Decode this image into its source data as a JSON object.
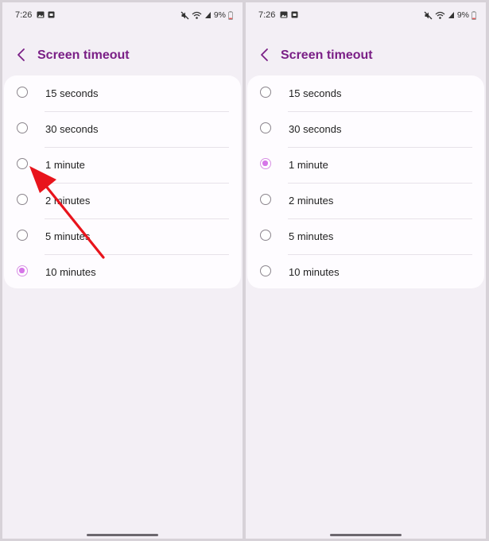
{
  "left_screen": {
    "status": {
      "time": "7:26",
      "battery": "9%"
    },
    "title": "Screen timeout",
    "options": [
      {
        "label": "15 seconds",
        "selected": false
      },
      {
        "label": "30 seconds",
        "selected": false
      },
      {
        "label": "1 minute",
        "selected": false
      },
      {
        "label": "2 minutes",
        "selected": false
      },
      {
        "label": "5 minutes",
        "selected": false
      },
      {
        "label": "10 minutes",
        "selected": true
      }
    ]
  },
  "right_screen": {
    "status": {
      "time": "7:26",
      "battery": "9%"
    },
    "title": "Screen timeout",
    "options": [
      {
        "label": "15 seconds",
        "selected": false
      },
      {
        "label": "30 seconds",
        "selected": false
      },
      {
        "label": "1 minute",
        "selected": true
      },
      {
        "label": "2 minutes",
        "selected": false
      },
      {
        "label": "5 minutes",
        "selected": false
      },
      {
        "label": "10 minutes",
        "selected": false
      }
    ]
  },
  "colors": {
    "title": "#7a1f86",
    "radio_selected": "#d676e8",
    "annotation_arrow": "#e8141c"
  },
  "icons": {
    "status_left": [
      "gallery-icon",
      "screenshot-icon"
    ],
    "status_right": [
      "mute-icon",
      "wifi-icon",
      "signal-icon",
      "battery-icon"
    ],
    "back": "chevron-left-icon",
    "annotation": "red-arrow-icon"
  }
}
